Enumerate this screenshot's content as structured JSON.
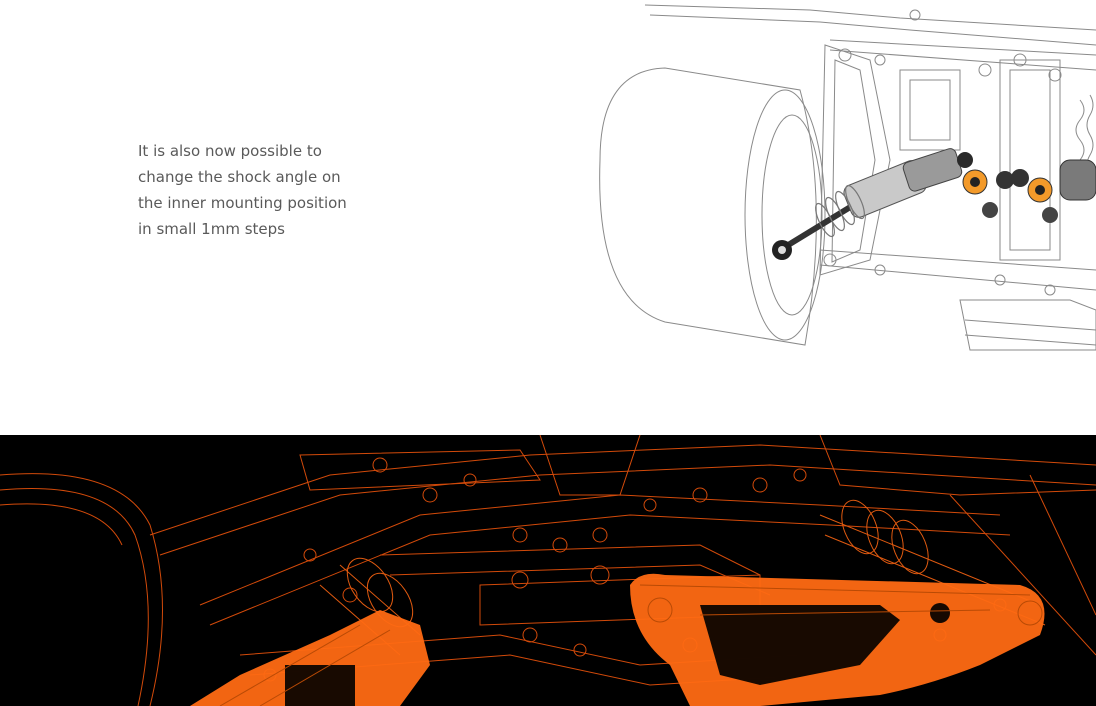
{
  "feature": {
    "caption": "It is also now possible to\nchange the shock angle on\nthe inner mounting position\nin small 1mm steps"
  },
  "colors": {
    "line_art": "#7a7a7a",
    "accent": "#ff6a13",
    "shock_orange": "#f39a2a",
    "dark_bg": "#000000"
  }
}
